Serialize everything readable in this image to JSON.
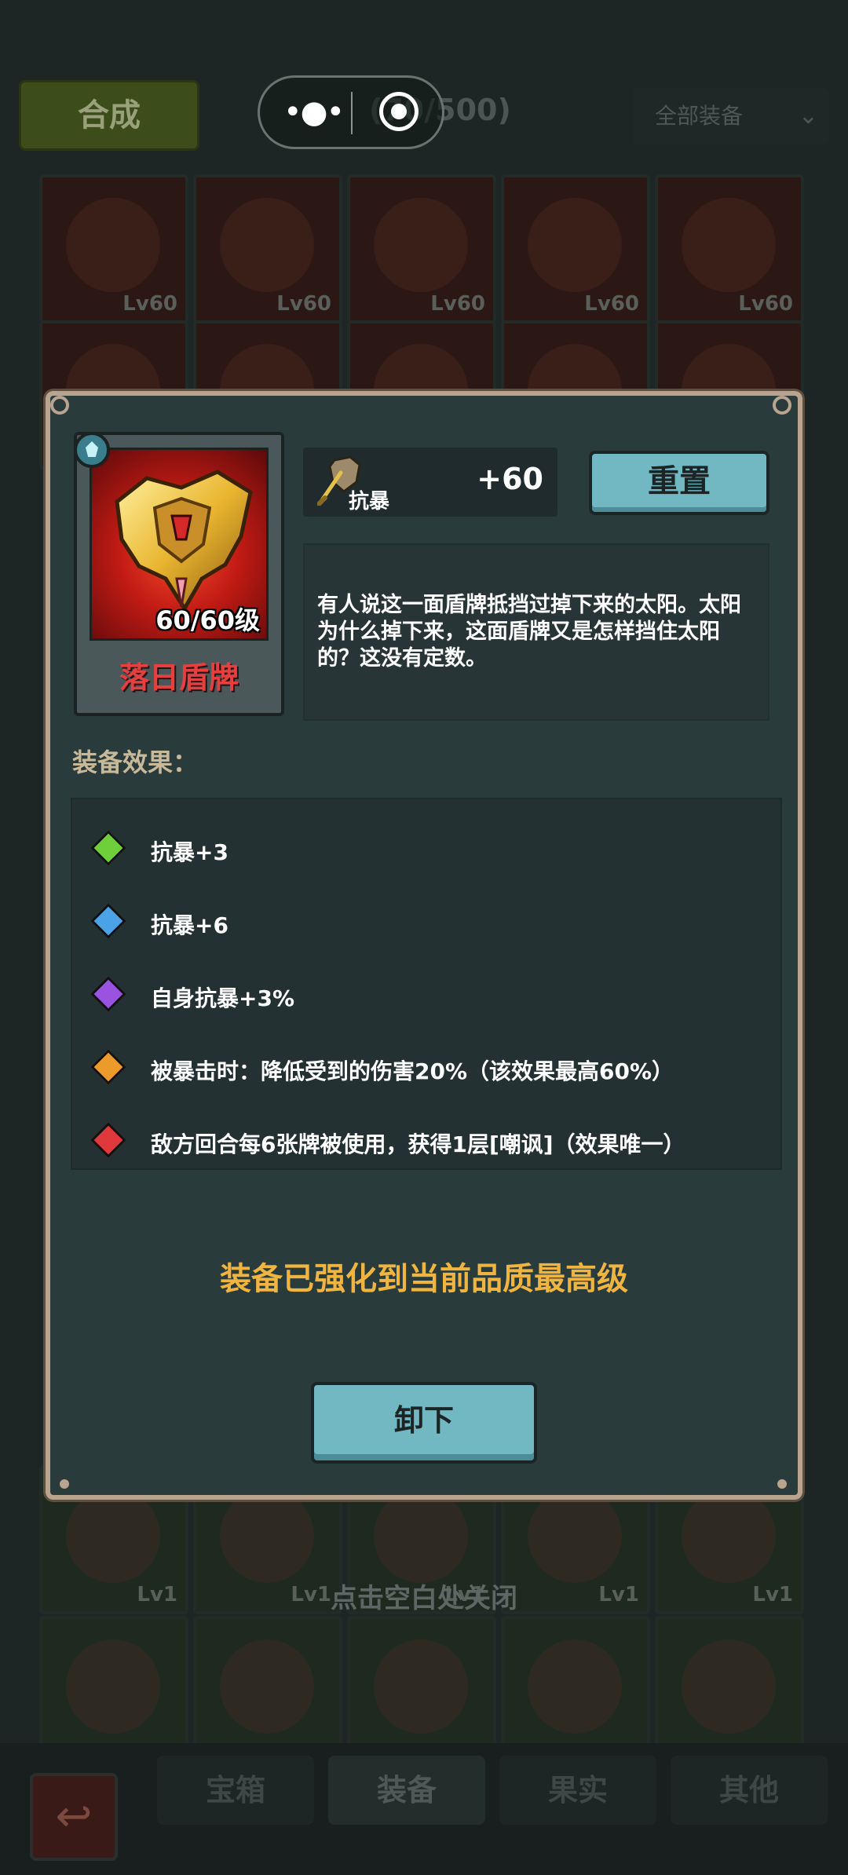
{
  "background": {
    "synth_button": "合成",
    "bag_count": "(70/500)",
    "filter": "全部装备",
    "grid_levels_row1": [
      "Lv60",
      "Lv60",
      "Lv60",
      "Lv60",
      "Lv60"
    ],
    "grid_levels_row3": [
      "Lv1",
      "Lv1",
      "Lv1",
      "Lv1",
      "Lv1"
    ],
    "close_hint": "点击空白处关闭",
    "tabs": [
      "宝箱",
      "装备",
      "果实",
      "其他"
    ]
  },
  "capsule": {
    "menu_icon": "more-dots-icon",
    "close_icon": "target-icon"
  },
  "item": {
    "name": "落日盾牌",
    "level": "60/60级",
    "art_icon": "golden-shield-icon",
    "quality_icon": "quality-gem-icon"
  },
  "stat": {
    "name": "抗暴",
    "value": "+60",
    "icon": "shield-sword-icon"
  },
  "reset_button": "重置",
  "description": "有人说这一面盾牌抵挡过掉下来的太阳。太阳为什么掉下来，这面盾牌又是怎样挡住太阳的？这没有定数。",
  "effects_title": "装备效果：",
  "effects": [
    {
      "text": "抗暴+3",
      "color": "#6fcf3a"
    },
    {
      "text": "抗暴+6",
      "color": "#4aa3e6"
    },
    {
      "text": "自身抗暴+3%",
      "color": "#9a52e0"
    },
    {
      "text": "被暴击时：降低受到的伤害20%（该效果最高60%）",
      "color": "#ec9a2a"
    },
    {
      "text": "敌方回合每6张牌被使用，获得1层[嘲讽]（效果唯一）",
      "color": "#e0393b"
    }
  ],
  "maxed_text": "装备已强化到当前品质最高级",
  "unequip_button": "卸下"
}
